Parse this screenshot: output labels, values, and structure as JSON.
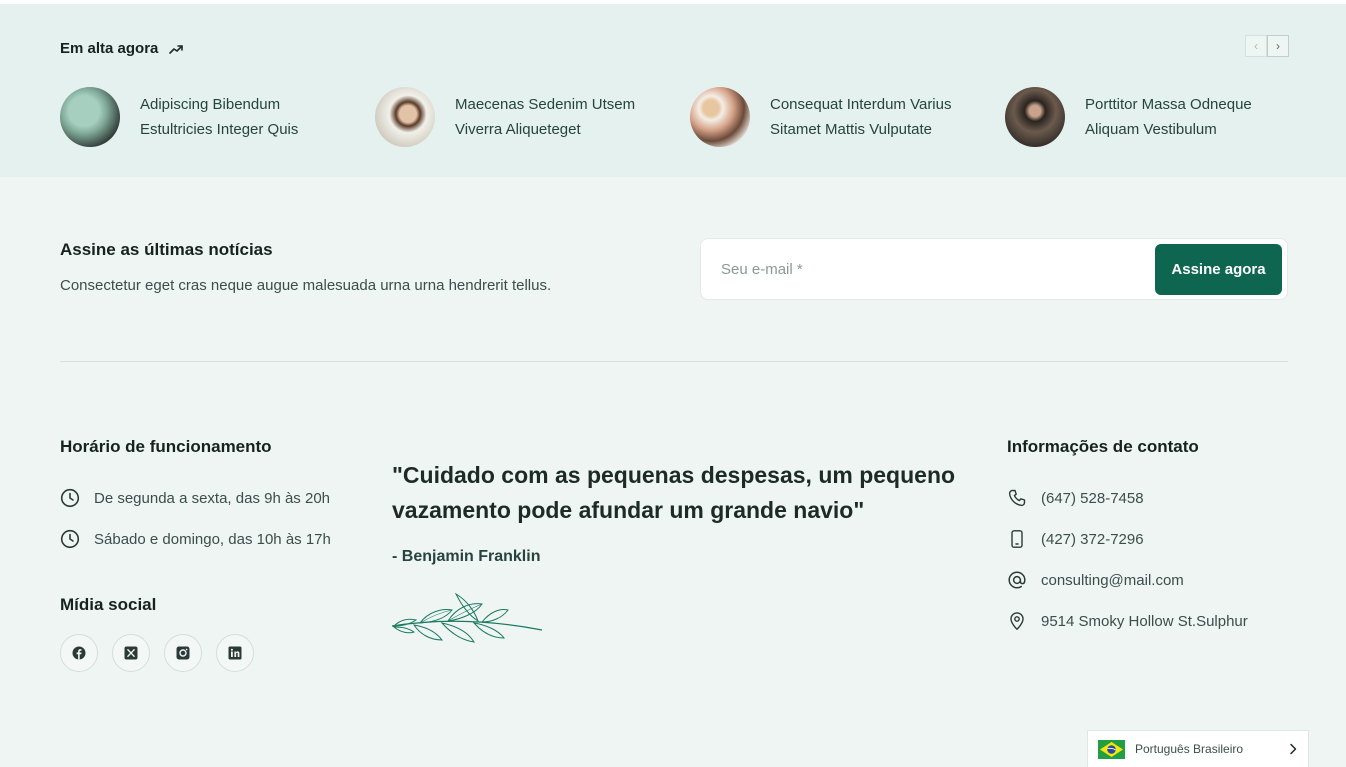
{
  "trending": {
    "title": "Em alta agora",
    "prev_label": "‹",
    "next_label": "›",
    "items": [
      {
        "line1": "Adipiscing Bibendum",
        "line2": "Estultricies Integer Quis"
      },
      {
        "line1": "Maecenas Sedenim Utsem",
        "line2": "Viverra Aliqueteget"
      },
      {
        "line1": "Consequat Interdum Varius",
        "line2": "Sitamet Mattis Vulputate"
      },
      {
        "line1": "Porttitor Massa Odneque",
        "line2": "Aliquam Vestibulum"
      }
    ]
  },
  "newsletter": {
    "title": "Assine as últimas notícias",
    "description": "Consectetur eget cras neque augue malesuada urna urna hendrerit tellus.",
    "email_placeholder": "Seu e-mail *",
    "button_label": "Assine agora"
  },
  "hours": {
    "title": "Horário de funcionamento",
    "weekdays": "De segunda a sexta, das 9h às 20h",
    "weekend": "Sábado e domingo, das 10h às 17h"
  },
  "social": {
    "title": "Mídia social",
    "icons": [
      "facebook-icon",
      "x-icon",
      "instagram-icon",
      "linkedin-icon"
    ]
  },
  "quote": {
    "text": "\"Cuidado com as pequenas despesas, um pequeno vazamento pode afundar um grande navio\"",
    "author": "- Benjamin Franklin"
  },
  "contact": {
    "title": "Informações de contato",
    "phone": "(647) 528-7458",
    "mobile": "(427) 372-7296",
    "email": "consulting@mail.com",
    "address": "9514 Smoky Hollow St.Sulphur"
  },
  "language": {
    "label": "Português Brasileiro",
    "flag": "brazil-flag-icon"
  },
  "colors": {
    "accent": "#0f6650",
    "trending_bg": "#e5f1ee",
    "page_bg": "#eff5f3"
  }
}
